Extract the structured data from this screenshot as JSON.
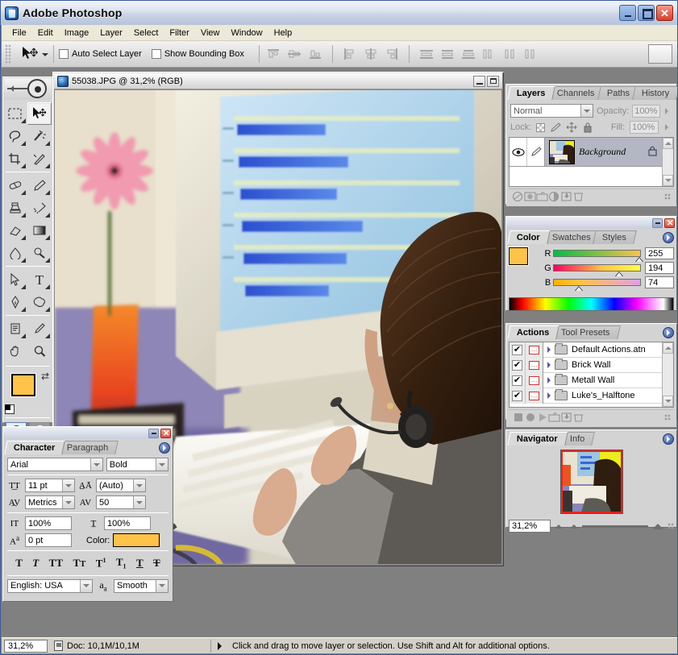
{
  "app": {
    "title": "Adobe Photoshop",
    "icon": "photoshop-icon"
  },
  "window_buttons": {
    "minimize": "_",
    "maximize": "□",
    "close": "✕"
  },
  "menubar": {
    "items": [
      "File",
      "Edit",
      "Image",
      "Layer",
      "Select",
      "Filter",
      "View",
      "Window",
      "Help"
    ]
  },
  "options_bar": {
    "tool_icon": "move-tool-icon",
    "checkboxes": [
      {
        "label": "Auto Select Layer",
        "checked": false
      },
      {
        "label": "Show Bounding Box",
        "checked": false
      }
    ],
    "align_icons": [
      "align-top-edges",
      "align-vertical-centers",
      "align-bottom-edges",
      "align-left-edges",
      "align-horizontal-centers",
      "align-right-edges",
      "distribute-top-edges",
      "distribute-vertical-centers",
      "distribute-bottom-edges",
      "distribute-left-edges",
      "distribute-horizontal-centers",
      "distribute-right-edges"
    ]
  },
  "toolbox": {
    "tools": [
      [
        "rectangular-marquee-tool",
        "move-tool"
      ],
      [
        "lasso-tool",
        "magic-wand-tool"
      ],
      [
        "crop-tool",
        "slice-tool"
      ],
      [
        "healing-brush-tool",
        "brush-tool"
      ],
      [
        "clone-stamp-tool",
        "history-brush-tool"
      ],
      [
        "eraser-tool",
        "gradient-tool"
      ],
      [
        "blur-tool",
        "dodge-tool"
      ],
      [
        "path-selection-tool",
        "type-tool"
      ],
      [
        "pen-tool",
        "custom-shape-tool"
      ],
      [
        "notes-tool",
        "eyedropper-tool"
      ],
      [
        "hand-tool",
        "zoom-tool"
      ]
    ],
    "selected_tool": "move-tool",
    "foreground_color": "#FFC24A",
    "background_color": "#F7A84E",
    "swap_colors_icon": "swap-colors-icon",
    "default_colors_icon": "default-colors-icon",
    "mask_modes": [
      "standard-mask-mode",
      "quick-mask-mode"
    ],
    "screen_modes": [
      "standard-screen-mode",
      "full-screen-with-menu-mode",
      "full-screen-mode"
    ],
    "jump_to_imageready_icon": "jump-to-imageready-icon"
  },
  "document": {
    "title": "55038.JPG @ 31,2% (RGB)",
    "icon": "document-icon",
    "buttons": {
      "minimize": "minimize-icon",
      "maximize": "maximize-icon"
    }
  },
  "layers_panel": {
    "tabs": [
      "Layers",
      "Channels",
      "Paths",
      "History"
    ],
    "active_tab": "Layers",
    "blend_mode": "Normal",
    "opacity_label": "Opacity:",
    "opacity_value": "100%",
    "lock_label": "Lock:",
    "lock_icons": [
      "lock-transparent-pixels",
      "lock-image-pixels",
      "lock-position",
      "lock-all"
    ],
    "fill_label": "Fill:",
    "fill_value": "100%",
    "layers": [
      {
        "name": "Background",
        "visible": true,
        "locked": true,
        "selected": true
      }
    ],
    "footer_icons": [
      "layer-style-icon",
      "layer-mask-icon",
      "new-group-icon",
      "adjustment-layer-icon",
      "new-layer-icon",
      "delete-layer-icon"
    ]
  },
  "color_panel": {
    "tabs": [
      "Color",
      "Swatches",
      "Styles"
    ],
    "active_tab": "Color",
    "channels": [
      {
        "label": "R",
        "value": "255",
        "pct": 100
      },
      {
        "label": "G",
        "value": "194",
        "pct": 76
      },
      {
        "label": "B",
        "value": "74",
        "pct": 29
      }
    ],
    "foreground_color": "#FFC24A",
    "background_color": "#F7A04E"
  },
  "actions_panel": {
    "tabs": [
      "Actions",
      "Tool Presets"
    ],
    "active_tab": "Actions",
    "rows": [
      {
        "name": "Default Actions.atn",
        "checked": true,
        "dialog": true
      },
      {
        "name": "Brick Wall",
        "checked": true,
        "dialog": true
      },
      {
        "name": "Metall Wall",
        "checked": true,
        "dialog": true
      },
      {
        "name": "Luke's_Halftone",
        "checked": true,
        "dialog": true
      }
    ],
    "footer_icons": [
      "stop-icon",
      "record-icon",
      "play-icon",
      "new-set-icon",
      "new-action-icon",
      "delete-icon"
    ]
  },
  "navigator_panel": {
    "tabs": [
      "Navigator",
      "Info"
    ],
    "active_tab": "Navigator",
    "zoom_value": "31,2%",
    "zoom_out_icon": "zoom-out-icon",
    "zoom_in_icon": "zoom-in-icon"
  },
  "character_panel": {
    "tabs": [
      "Character",
      "Paragraph"
    ],
    "active_tab": "Character",
    "font_family": "Arial",
    "font_style": "Bold",
    "font_size": "11 pt",
    "leading": "(Auto)",
    "kerning": "Metrics",
    "tracking": "50",
    "vertical_scale": "100%",
    "horizontal_scale": "100%",
    "baseline_shift": "0 pt",
    "color_label": "Color:",
    "text_color": "#FFC24A",
    "style_buttons": [
      "faux-bold",
      "faux-italic",
      "all-caps",
      "small-caps",
      "superscript",
      "subscript",
      "underline",
      "strikethrough"
    ],
    "language": "English: USA",
    "anti_alias": "Smooth",
    "anti_alias_icon": "anti-alias-icon"
  },
  "status_bar": {
    "zoom": "31,2%",
    "doc_icon": "document-size-icon",
    "doc_info": "Doc: 10,1M/10,1M",
    "hint": "Click and drag to move layer or selection.  Use Shift and Alt for additional options."
  },
  "canvas_image": {
    "description": "office-photo-person-at-computer",
    "wall_color": "#eeee22",
    "monitor_screen_color": "#a9cfe8",
    "bar_color": "#2f5fd0",
    "flower_color": "#f4a0b4",
    "vase_color": "#f26a2a",
    "keyboard_color": "#f0ede4",
    "jacket_color": "#5b5a58",
    "hair_color": "#3a2318",
    "desk_color": "#8a84b8"
  }
}
